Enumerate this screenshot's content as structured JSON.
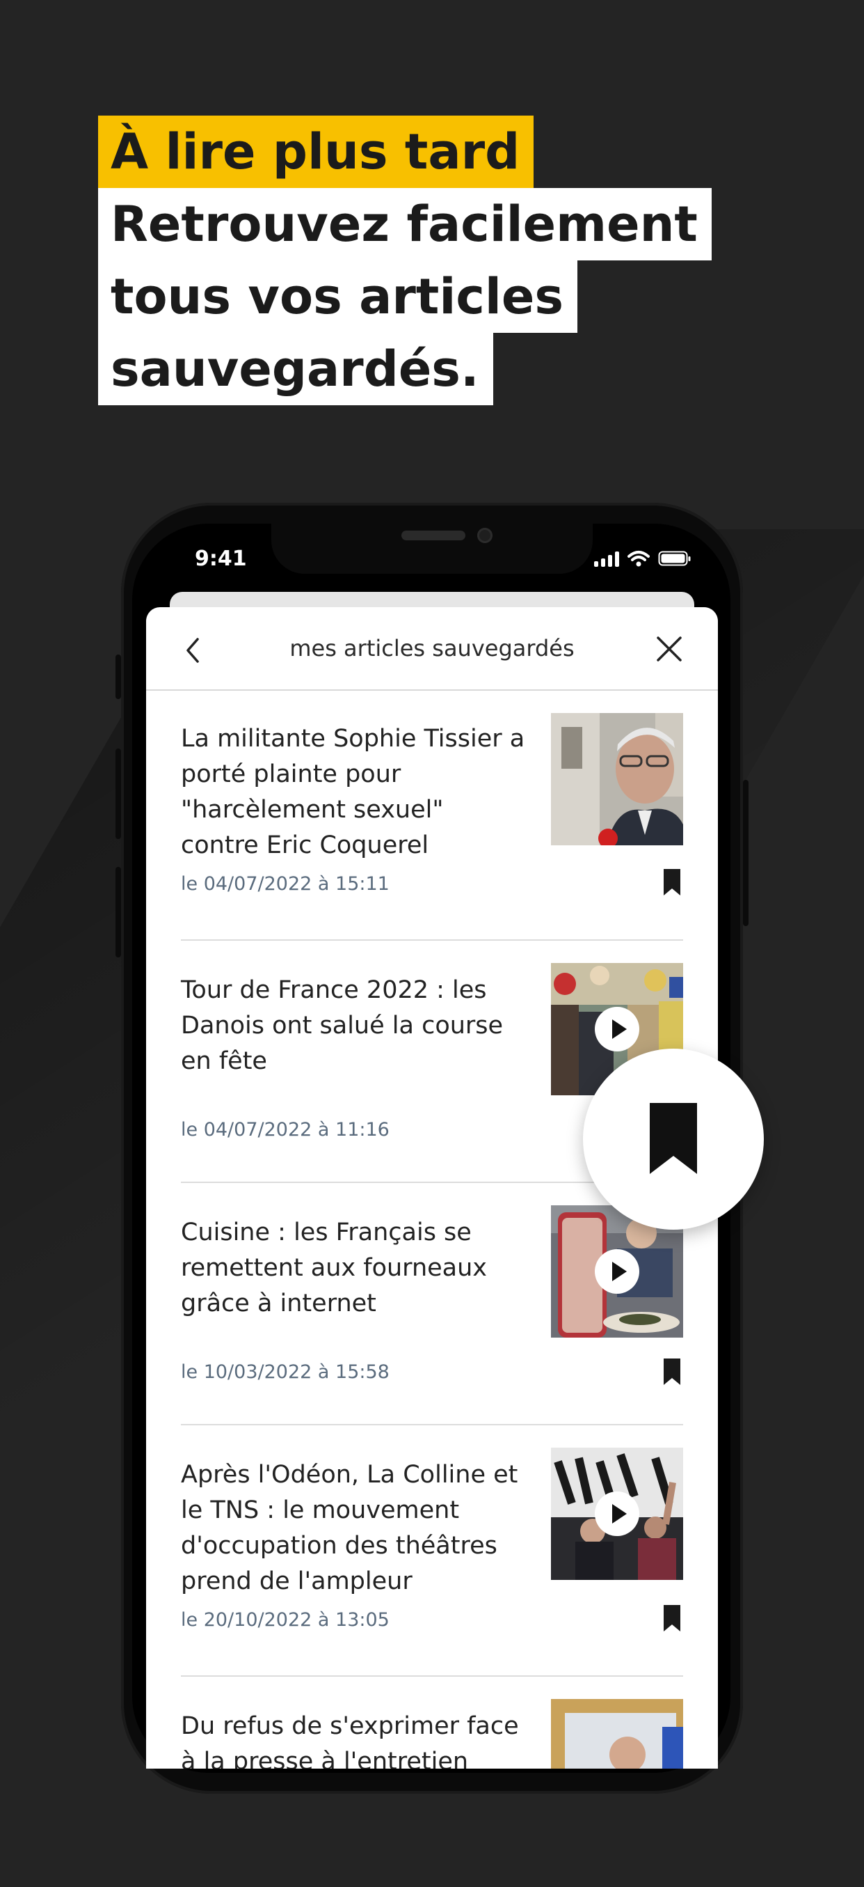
{
  "headline": {
    "line1": "À lire plus tard",
    "line2": "Retrouvez facilement",
    "line3": "tous vos articles",
    "line4": "sauvegardés."
  },
  "status_bar": {
    "time": "9:41"
  },
  "sheet": {
    "title": "mes articles sauvegardés"
  },
  "articles": [
    {
      "title": "La militante Sophie Tissier a porté plainte pour \"harcèlement sexuel\" contre Eric Coquerel",
      "date": "le 04/07/2022 à 15:11",
      "has_video": false
    },
    {
      "title": "Tour de France 2022 : les Danois ont salué la course en fête",
      "date": "le  04/07/2022 à 11:16",
      "has_video": true
    },
    {
      "title": "Cuisine : les Français se remettent aux fourneaux grâce à internet",
      "date": "le 10/03/2022 à 15:58",
      "has_video": true
    },
    {
      "title": "Après l'Odéon, La Colline et le TNS : le mouvement d'occupation des théâtres prend de l'ampleur",
      "date": "le 20/10/2022 à 13:05",
      "has_video": true
    },
    {
      "title": "Du refus de s'exprimer face à la presse à l'entretien",
      "date": "",
      "has_video": false
    }
  ],
  "colors": {
    "accent_yellow": "#f8c000",
    "background": "#242424",
    "date_text": "#5a6b7d"
  },
  "icons": [
    "back-chevron-icon",
    "close-icon",
    "bookmark-icon",
    "play-icon",
    "signal-icon",
    "wifi-icon",
    "battery-icon"
  ]
}
